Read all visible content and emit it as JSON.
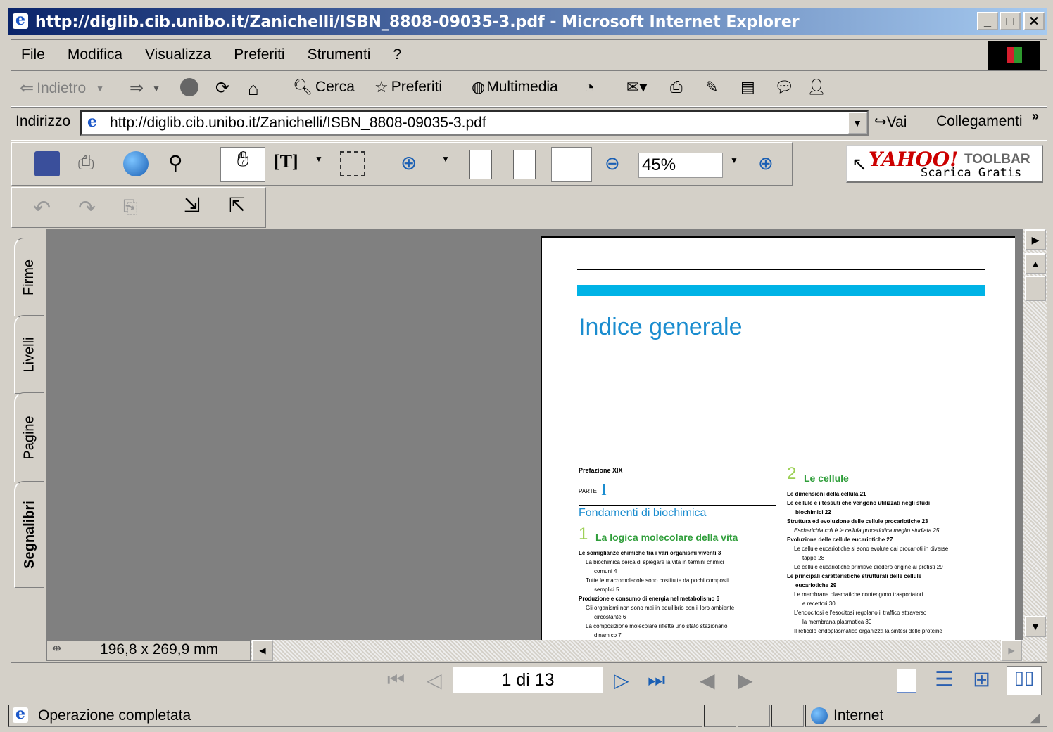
{
  "window": {
    "title": "http://diglib.cib.unibo.it/Zanichelli/ISBN_8808-09035-3.pdf - Microsoft Internet Explorer",
    "min": "_",
    "max": "□",
    "close": "✕"
  },
  "menu": [
    "File",
    "Modifica",
    "Visualizza",
    "Preferiti",
    "Strumenti",
    "?"
  ],
  "toolbar": {
    "back": "Indietro",
    "search": "Cerca",
    "favorites": "Preferiti",
    "media": "Multimedia"
  },
  "address": {
    "label": "Indirizzo",
    "url": "http://diglib.cib.unibo.it/Zanichelli/ISBN_8808-09035-3.pdf",
    "go": "Vai",
    "links": "Collegamenti",
    "chevron": "»"
  },
  "pdf_toolbar": {
    "zoom": "45%"
  },
  "yahoo": {
    "logo": "YAHOO!",
    "toolbar": "TOOLBAR",
    "cta": "Scarica Gratis"
  },
  "side_tabs": [
    "Firme",
    "Livelli",
    "Pagine",
    "Segnalibri"
  ],
  "page_size": "196,8 x 269,9 mm",
  "pager": {
    "current": "1 di 13"
  },
  "status": {
    "text": "Operazione completata",
    "zone": "Internet"
  },
  "document": {
    "title": "Indice generale",
    "prefazione": "Prefazione XIX",
    "parte_label": "PARTE",
    "parte_num": "I",
    "parte_title": "Fondamenti di biochimica",
    "ch1_num": "1",
    "ch1_title": "La logica molecolare della vita",
    "ch2_num": "2",
    "ch2_title": "Le cellule",
    "col1_lines": [
      "Le somiglianze chimiche tra i vari organismi viventi   3",
      "La biochimica cerca di spiegare la vita in termini chimici",
      "comuni   4",
      "Tutte le macromolecole sono costituite da pochi composti",
      "semplici   5",
      "Produzione e consumo di energia nel metabolismo   6",
      "Gli organismi non sono mai in equilibrio con il loro ambiente",
      "circostante   6",
      "La composizione molecolare riflette uno stato stazionario",
      "dinamico   7"
    ],
    "col2_lines": [
      "Le dimensioni della cellula   21",
      "Le cellule e i tessuti che vengono utilizzati negli studi",
      "biochimici   22",
      "Struttura ed evoluzione delle cellule procariotiche   23",
      "Escherichia coli è la cellula procariotica meglio studiata   25",
      "Evoluzione delle cellule eucariotiche   27",
      "Le cellule eucariotiche si sono evolute dai procarioti in diverse",
      "tappe   28",
      "Le cellule eucariotiche primitive diedero origine ai protisti   29",
      "Le principali caratteristiche strutturali delle cellule",
      "eucariotiche   29",
      "Le membrane plasmatiche contengono trasportatori",
      "e recettori   30",
      "L'endocitosi e l'esocitosi regolano il traffico attraverso",
      "la membrana plasmatica   30",
      "Il reticolo endoplasmatico organizza la sintesi delle proteine"
    ]
  },
  "colors": {
    "accent_cyan": "#00b3e6",
    "title_blue": "#1a8ccf",
    "chapter_green": "#2f9e3a",
    "viewer_gray": "#808080"
  }
}
